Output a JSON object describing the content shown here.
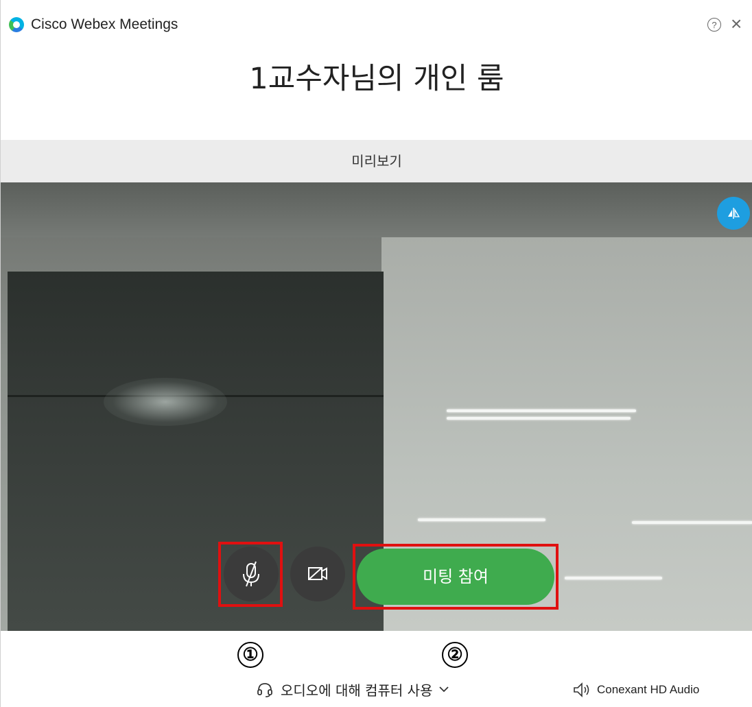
{
  "app": {
    "title": "Cisco Webex Meetings"
  },
  "room": {
    "title": "1교수자님의 개인 룸"
  },
  "preview": {
    "label": "미리보기"
  },
  "controls": {
    "join_label": "미팅 참여"
  },
  "annotations": {
    "marker1": "①",
    "marker2": "②"
  },
  "audio": {
    "connection_label": "오디오에 대해 컴퓨터 사용",
    "speaker_device": "Conexant HD Audio"
  },
  "colors": {
    "join_green": "#3fab4e",
    "mirror_blue": "#1e9ee0",
    "highlight_red": "#e01010"
  }
}
